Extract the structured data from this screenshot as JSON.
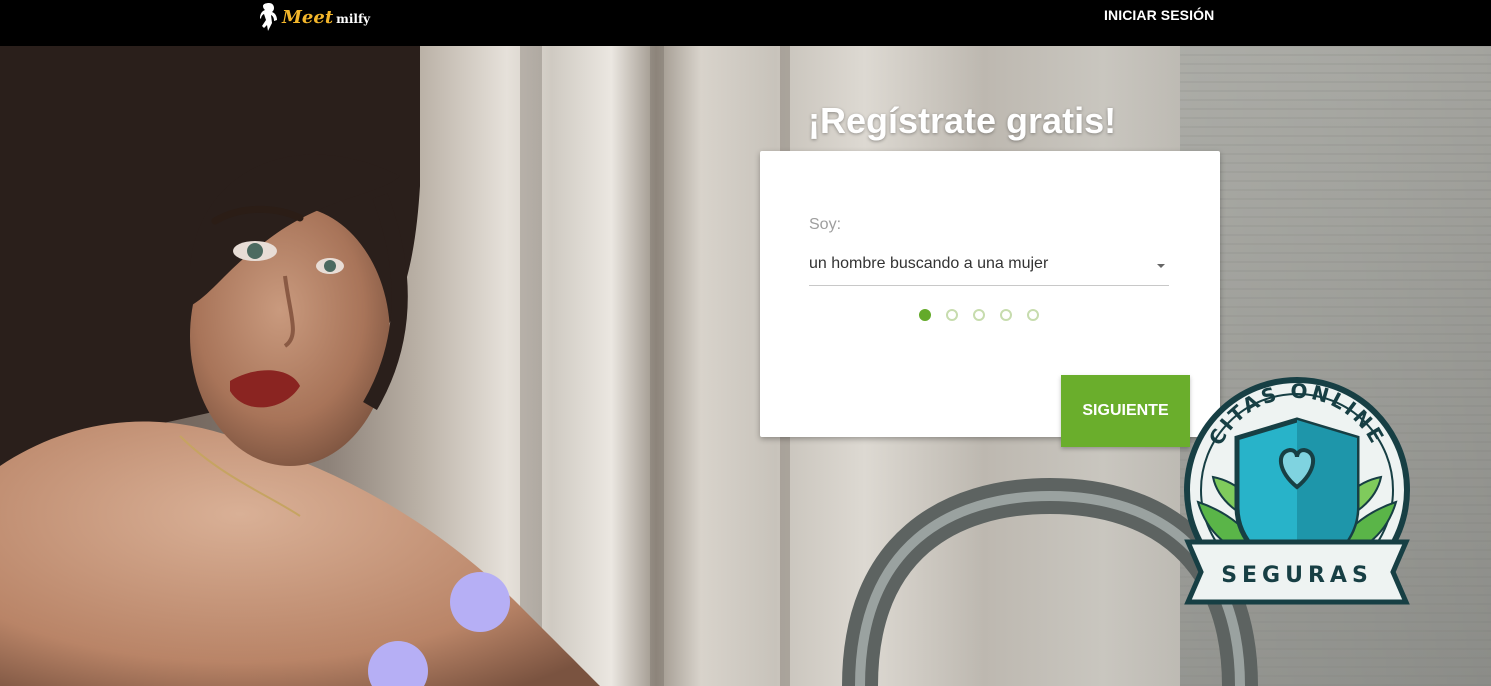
{
  "header": {
    "logo_part1": "Meet",
    "logo_part2": "milfy",
    "login_label": "INICIAR SESIÓN"
  },
  "registration": {
    "title": "¡Regístrate gratis!",
    "field_label": "Soy:",
    "selected_option": "un hombre buscando a una mujer",
    "steps_total": 5,
    "current_step": 1,
    "next_label": "SIGUIENTE"
  },
  "badge": {
    "top_text": "CITAS ONLINE",
    "bottom_text": "SEGURAS"
  },
  "colors": {
    "accent": "#6aae2c",
    "header_bg": "#000000",
    "logo": "#f3b62b"
  }
}
